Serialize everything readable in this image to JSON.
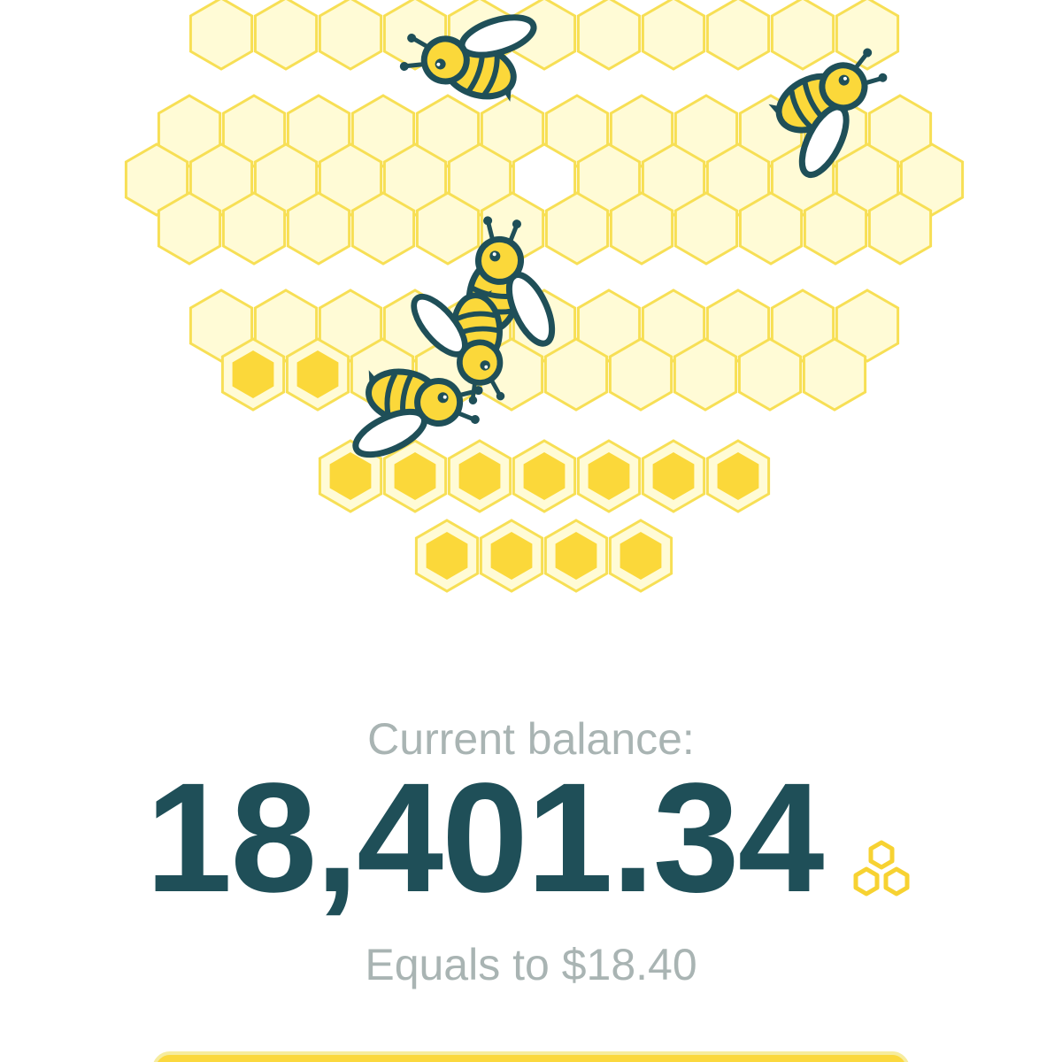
{
  "balance": {
    "label": "Current balance:",
    "amount": "18,401.34",
    "currency_icon": "honeycomb-icon",
    "equivalent": "Equals to $18.40"
  },
  "hive": {
    "pale_cell_color": "#fffbd6",
    "cell_stroke_color": "#f7df55",
    "honey_fill_color": "#fbd83a",
    "bee_body_color": "#fbd83a",
    "bee_outline_color": "#1f4f58",
    "bee_count": 5,
    "filled_cells": 13
  },
  "action": {
    "color": "#fbd83e"
  }
}
